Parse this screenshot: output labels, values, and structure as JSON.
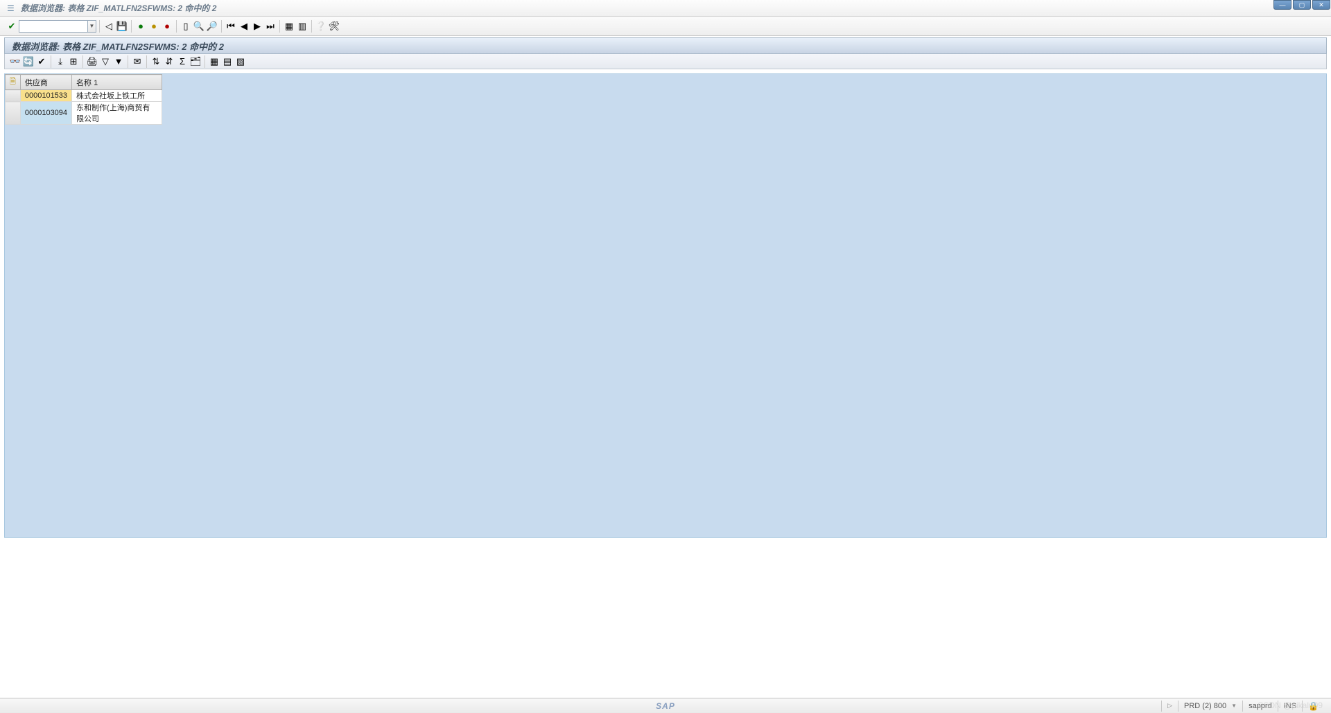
{
  "window": {
    "title": "数据浏览器: 表格 ZIF_MATLFN2SFWMS:        2 命中的        2"
  },
  "page_header": {
    "title": "数据浏览器: 表格 ZIF_MATLFN2SFWMS:        2 命中的        2"
  },
  "command_field": {
    "value": "",
    "placeholder": ""
  },
  "table": {
    "columns": [
      {
        "key": "supplier",
        "label": "供应商"
      },
      {
        "key": "name1",
        "label": "名称 1"
      }
    ],
    "rows": [
      {
        "supplier": "0000101533",
        "name1": "株式会社坂上铁工所"
      },
      {
        "supplier": "0000103094",
        "name1": "东和制作(上海)商贸有限公司"
      }
    ]
  },
  "statusbar": {
    "sap_logo": "SAP",
    "system": "PRD (2) 800",
    "server": "sapprd",
    "mode": "INS"
  },
  "watermark": "CSDN @pikalu09",
  "icons": {
    "check": "✔",
    "back_tri": "◁",
    "save_disk": "💾",
    "green_ball": "●",
    "yellow_ball": "●",
    "red_ball": "●",
    "page": "▯",
    "binoculars": "🔍",
    "binoculars_plus": "🔎",
    "first": "⏮",
    "prev": "◀",
    "next": "▶",
    "last": "⏭",
    "grid": "▦",
    "grid2": "▥",
    "help": "❔",
    "tool": "🛠",
    "glasses": "👓",
    "refresh": "🔄",
    "check2": "✔",
    "export": "⤓",
    "excel": "⊞",
    "print": "🖨",
    "filter": "▽",
    "filter_x": "▼",
    "mail": "✉",
    "sort_a": "⇅",
    "sort_d": "⇵",
    "sum": "Σ",
    "detail": "🗂",
    "layout": "▦",
    "layout2": "▤",
    "layout3": "▧",
    "doc_corner": "🗎",
    "lock": "🔒",
    "tri_right": "▷",
    "dd": "▼"
  }
}
